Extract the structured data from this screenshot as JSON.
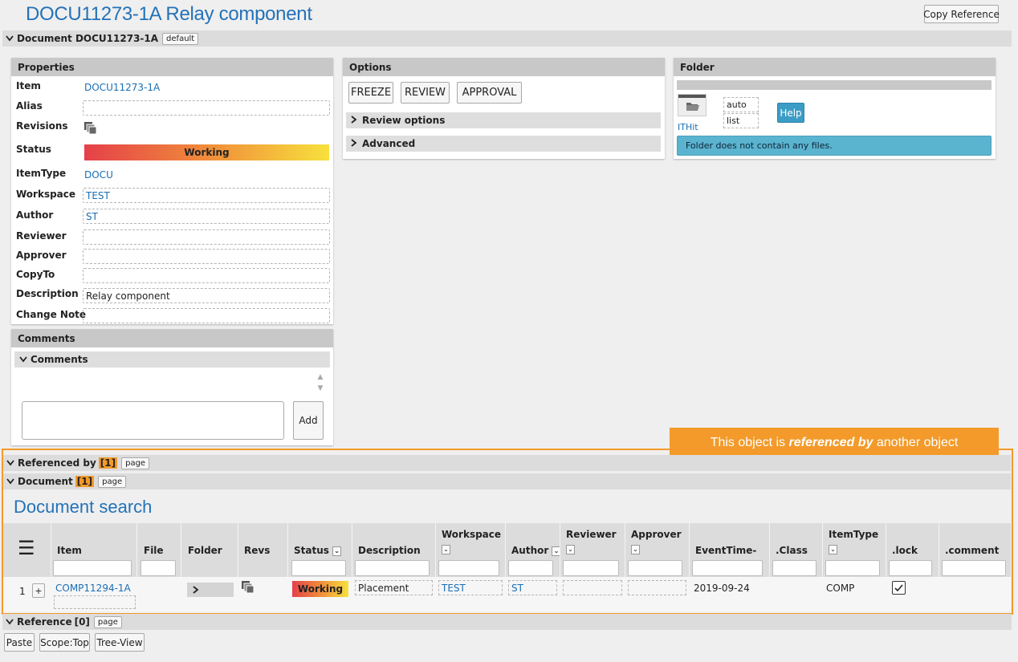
{
  "header": {
    "title": "DOCU11273-1A Relay component",
    "copy_reference": "Copy Reference"
  },
  "document_section": {
    "label": "Document DOCU11273-1A",
    "tag": "default"
  },
  "properties": {
    "title": "Properties",
    "rows": [
      {
        "label": "Item",
        "value": "DOCU11273-1A"
      },
      {
        "label": "Alias",
        "value": ""
      },
      {
        "label": "Revisions",
        "value": ""
      },
      {
        "label": "Status",
        "value": "Working"
      },
      {
        "label": "ItemType",
        "value": "DOCU"
      },
      {
        "label": "Workspace",
        "value": "TEST"
      },
      {
        "label": "Author",
        "value": "ST"
      },
      {
        "label": "Reviewer",
        "value": ""
      },
      {
        "label": "Approver",
        "value": ""
      },
      {
        "label": "CopyTo",
        "value": ""
      },
      {
        "label": "Description",
        "value": "Relay component"
      },
      {
        "label": "Change Note",
        "value": ""
      }
    ],
    "status_colors": [
      "#e5404a",
      "#f08c3a",
      "#f7e13c"
    ]
  },
  "comments": {
    "title": "Comments",
    "sub_title": "Comments",
    "add_label": "Add"
  },
  "options": {
    "title": "Options",
    "buttons": [
      "FREEZE",
      "REVIEW",
      "APPROVAL"
    ],
    "review_options": "Review options",
    "advanced": "Advanced"
  },
  "folder": {
    "title": "Folder",
    "folder_name": "ITHit",
    "view_auto": "auto",
    "view_list": "list",
    "help_label": "Help",
    "empty_message": "Folder does not contain any files.",
    "info_color": "#5ab4d0"
  },
  "annotation": {
    "text_before": "This object is ",
    "text_emph": "referenced by",
    "text_after": " another object",
    "color": "#f39a2a"
  },
  "referenced_by": {
    "label": "Referenced by",
    "count": "[1]",
    "tag": "page"
  },
  "document_ref": {
    "label": "Document",
    "count": "[1]",
    "tag": "page"
  },
  "search": {
    "title": "Document search",
    "columns": [
      "Item",
      "File",
      "Folder",
      "Revs",
      "Status",
      "Description",
      "Workspace",
      "Author",
      "Reviewer",
      "Approver",
      "EventTime-",
      ".Class",
      "ItemType",
      ".lock",
      ".comment"
    ],
    "row": {
      "index": "1",
      "expand": "+",
      "item": "COMP11294-1A",
      "status": "Working",
      "description": "Placement",
      "workspace": "TEST",
      "author": "ST",
      "reviewer": "",
      "approver": "",
      "event_time": "2019-09-24",
      "item_class": "",
      "item_type": "COMP",
      "lock_checked": true,
      "comment": ""
    }
  },
  "reference": {
    "label": "Reference",
    "count": "[0]",
    "tag": "page"
  },
  "bottom_buttons": [
    "Paste",
    "Scope:Top",
    "Tree-View"
  ]
}
